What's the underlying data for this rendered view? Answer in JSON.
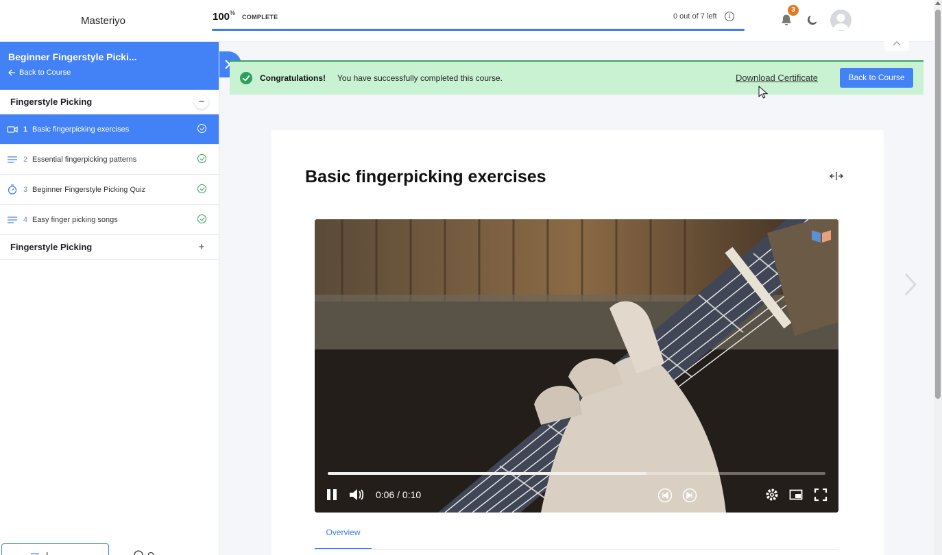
{
  "header": {
    "brand": "Masteriyo",
    "progress_percent": "100",
    "progress_unit": "%",
    "progress_label": "COMPLETE",
    "progress_fraction": 1.0,
    "lessons_left": "0 out of 7 left",
    "notification_count": "3"
  },
  "sidebar": {
    "course_title": "Beginner Fingerstyle Picki...",
    "back_link": "Back to Course",
    "sections": [
      {
        "title": "Fingerstyle Picking",
        "expanded": true,
        "lessons": [
          {
            "num": "1",
            "title": "Basic fingerpicking exercises",
            "icon": "video-icon",
            "active": true,
            "completed": true
          },
          {
            "num": "2",
            "title": "Essential fingerpicking patterns",
            "icon": "text-lines-icon",
            "active": false,
            "completed": true
          },
          {
            "num": "3",
            "title": "Beginner Fingerstyle Picking Quiz",
            "icon": "stopwatch-icon",
            "active": false,
            "completed": true
          },
          {
            "num": "4",
            "title": "Easy finger picking songs",
            "icon": "text-lines-icon",
            "active": false,
            "completed": true
          }
        ]
      },
      {
        "title": "Fingerstyle Picking",
        "expanded": false,
        "lessons": []
      }
    ],
    "bottom_tabs": [
      "L",
      "Q"
    ]
  },
  "alert": {
    "title": "Congratulations!",
    "message": "You have successfully completed this course.",
    "download_label": "Download Certificate",
    "back_label": "Back to Course"
  },
  "lesson": {
    "title": "Basic fingerpicking exercises",
    "video": {
      "current_time": "0:06",
      "duration": "0:10",
      "played_fraction": 0.64
    },
    "tabs": [
      "Overview"
    ]
  },
  "colors": {
    "accent": "#4281f6",
    "success": "#2c9f5a",
    "alert_bg": "#c8f2d2",
    "badge": "#e07b22"
  }
}
